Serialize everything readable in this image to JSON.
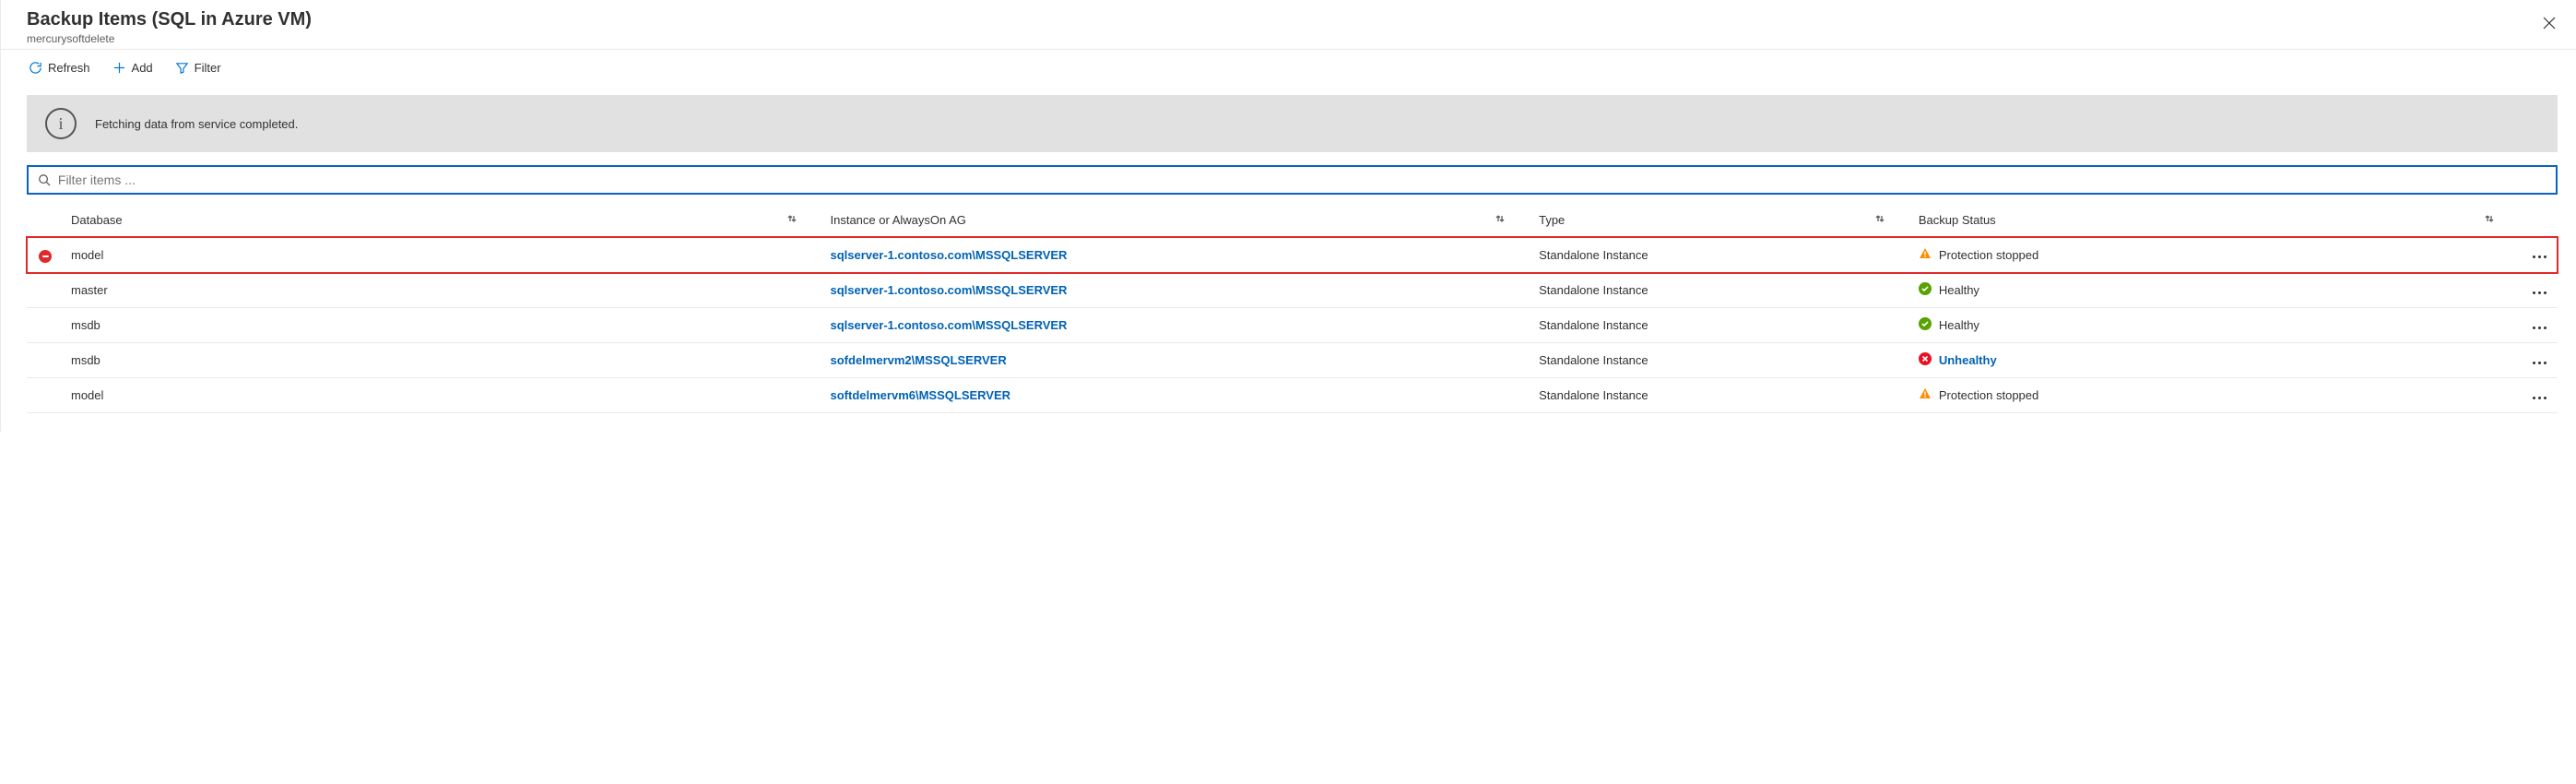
{
  "header": {
    "title": "Backup Items (SQL in Azure VM)",
    "subtitle": "mercurysoftdelete"
  },
  "toolbar": {
    "refresh": "Refresh",
    "add": "Add",
    "filter": "Filter"
  },
  "info_bar": {
    "message": "Fetching data from service completed."
  },
  "filter": {
    "placeholder": "Filter items ..."
  },
  "columns": {
    "database": "Database",
    "instance": "Instance or AlwaysOn AG",
    "type": "Type",
    "status": "Backup Status"
  },
  "rows": [
    {
      "database": "model",
      "instance": "sqlserver-1.contoso.com\\MSSQLSERVER",
      "type": "Standalone Instance",
      "status_kind": "warn",
      "status_text": "Protection stopped",
      "highlight": true,
      "leading_icon": "stop"
    },
    {
      "database": "master",
      "instance": "sqlserver-1.contoso.com\\MSSQLSERVER",
      "type": "Standalone Instance",
      "status_kind": "healthy",
      "status_text": "Healthy",
      "highlight": false,
      "leading_icon": ""
    },
    {
      "database": "msdb",
      "instance": "sqlserver-1.contoso.com\\MSSQLSERVER",
      "type": "Standalone Instance",
      "status_kind": "healthy",
      "status_text": "Healthy",
      "highlight": false,
      "leading_icon": ""
    },
    {
      "database": "msdb",
      "instance": "sofdelmervm2\\MSSQLSERVER",
      "type": "Standalone Instance",
      "status_kind": "unhealthy",
      "status_text": "Unhealthy",
      "highlight": false,
      "leading_icon": ""
    },
    {
      "database": "model",
      "instance": "softdelmervm6\\MSSQLSERVER",
      "type": "Standalone Instance",
      "status_kind": "warn",
      "status_text": "Protection stopped",
      "highlight": false,
      "leading_icon": ""
    }
  ]
}
